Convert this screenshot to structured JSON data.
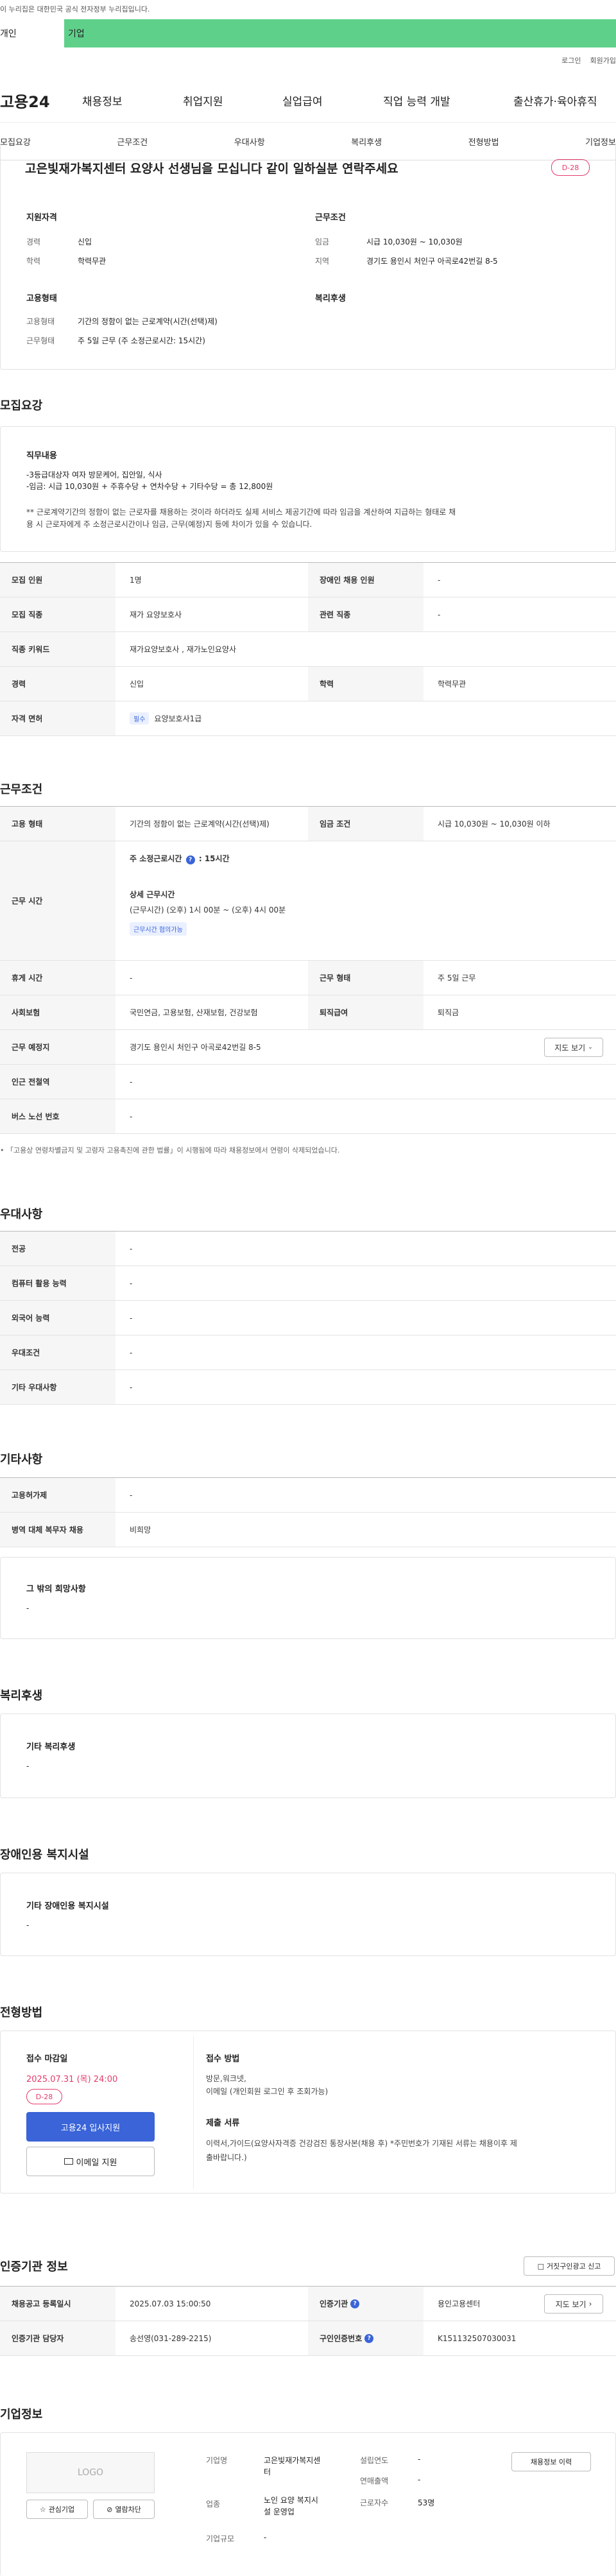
{
  "gov_banner": "이 누리집은 대한민국 공식 전자정부 누리집입니다.",
  "user_tabs": {
    "personal": "개인",
    "company": "기업"
  },
  "top_links": {
    "login": "로그인",
    "signup": "회원가입"
  },
  "gnb": {
    "logo": "고용24",
    "items": [
      "채용정보",
      "취업지원",
      "실업급여",
      "직업 능력 개발",
      "출산휴가·육아휴직"
    ]
  },
  "snb": [
    "모집요강",
    "근무조건",
    "우대사항",
    "복리후생",
    "전형방법",
    "기업정보"
  ],
  "job": {
    "title": "고은빛재가복지센터 요양사 선생님을 모십니다 같이 일하실분 연락주세요",
    "dday": "D-28",
    "qual_title": "지원자격",
    "career_label": "경력",
    "career_value": "신입",
    "edu_label": "학력",
    "edu_value": "학력무관",
    "cond_title": "근무조건",
    "wage_label": "임금",
    "wage_value": "시급 10,030원 ~ 10,030원",
    "region_label": "지역",
    "region_value": "경기도 용인시 처인구 아곡로42번길 8-5",
    "employ_title": "고용형태",
    "employ_type_label": "고용형태",
    "employ_type_value": "기간의 정함이 없는 근로계약(시간(선택)제)",
    "work_form_label": "근무형태",
    "work_form_value": "주 5일 근무 (주 소정근로시간: 15시간)",
    "welfare_title": "복리후생"
  },
  "recruit": {
    "section_title": "모집요강",
    "duty_title": "직무내용",
    "duty_lines": [
      "-3등급대상자 여자 방문케어, 집안일, 식사",
      "-임금: 시급 10,030원 + 주휴수당 + 연차수당 + 기타수당 = 총 12,800원"
    ],
    "notice_lines": [
      "** 근로계약기간의 정함이 없는 근로자를 채용하는 것이라 하더라도 실제 서비스 제공기간에 따라 임금을 계산하여 지급하는 형태로 채",
      "용 시 근로자에게 주 소정근로시간이나 임금, 근무(예정)지 등에 차이가 있을 수 있습니다."
    ],
    "count_label": "모집 인원",
    "count_value": "1명",
    "disabled_label": "장애인 채용 인원",
    "disabled_value": "-",
    "job_label": "모집 직종",
    "job_value": "재가 요양보호사",
    "related_label": "관련 직종",
    "related_value": "-",
    "keyword_label": "직종 키워드",
    "keyword_value": "재가요양보호사 , 재가노인요양사",
    "career_label": "경력",
    "career_value": "신입",
    "edu_label": "학력",
    "edu_value": "학력무관",
    "license_label": "자격 면허",
    "license_tag": "필수",
    "license_value": "요양보호사1급"
  },
  "work": {
    "section_title": "근무조건",
    "employ_label": "고용 형태",
    "employ_value": "기간의 정함이 없는 근로계약(시간(선택)제)",
    "wage_label": "임금 조건",
    "wage_value": "시급 10,030원 ~ 10,030원 이하",
    "hours_label": "근무 시간",
    "weekly_hours": "주 소정근로시간",
    "weekly_hours_value": ": 15시간",
    "detail_title": "상세 근무시간",
    "detail_value": "(근무시간) (오후) 1시 00분 ~ (오후) 4시 00분",
    "negotiable_tag": "근무시간 협의가능",
    "break_label": "휴게 시간",
    "break_value": "-",
    "form_label": "근무 형태",
    "form_value": "주 5일 근무",
    "insurance_label": "사회보험",
    "insurance_value": "국민연금, 고용보험, 산재보험, 건강보험",
    "severance_label": "퇴직급여",
    "severance_value": "퇴직금",
    "place_label": "근무 예정지",
    "place_value": "경기도 용인시 처인구 아곡로42번길 8-5",
    "map_button": "지도 보기",
    "subway_label": "인근 전철역",
    "subway_value": "-",
    "bus_label": "버스 노선 번호",
    "bus_value": "-",
    "footnote": "「고용상 연령차별금지 및 고령자 고용촉진에 관한 법률」이 시행됨에 따라 채용정보에서 연령이 삭제되었습니다."
  },
  "pref": {
    "section_title": "우대사항",
    "rows": [
      {
        "label": "전공",
        "value": "-"
      },
      {
        "label": "컴퓨터 활용 능력",
        "value": "-"
      },
      {
        "label": "외국어 능력",
        "value": "-"
      },
      {
        "label": "우대조건",
        "value": "-"
      },
      {
        "label": "기타 우대사항",
        "value": "-"
      }
    ]
  },
  "etc": {
    "section_title": "기타사항",
    "disabled_label": "고용허가제",
    "disabled_value": "-",
    "military_label": "병역 대체 복무자 채용",
    "military_value": "비희망",
    "other_title": "그 밖의 희망사항",
    "other_value": "-"
  },
  "welfare": {
    "section_title": "복리후생",
    "box_title": "기타 복리후생",
    "box_value": "-"
  },
  "facility": {
    "section_title": "장애인용 복지시설",
    "box_title": "기타 장애인용 복지시설",
    "box_value": "-"
  },
  "process": {
    "section_title": "전형방법",
    "deadline_title": "접수 마감일",
    "deadline_value": "2025.07.31 (목) 24:00",
    "dday": "D-28",
    "apply_button": "고용24 입사지원",
    "email_button": "이메일 지원",
    "method_title": "접수 방법",
    "method_lines": [
      "방문,워크넷,",
      "이메일 (개인회원 로그인 후 조회가능)"
    ],
    "docs_title": "제출 서류",
    "docs_lines": [
      "이력서,가이드(요양사자격증 건강검진 통장사본(채용 후) *주민번호가 기재된 서류는 채용이후 제",
      "출바랍니다.)"
    ]
  },
  "cert": {
    "section_title": "인증기관 정보",
    "report_button": "거짓구인광고 신고",
    "reg_label": "채용공고 등록일시",
    "reg_value": "2025.07.03 15:00:50",
    "org_label": "인증기관",
    "org_value": "용인고용센터",
    "map_button": "지도 보기",
    "manager_label": "인증기관 담당자",
    "manager_value": "송선영(031-289-2215)",
    "certno_label": "구인인증번호",
    "certno_value": "K151132507030031"
  },
  "company": {
    "section_title": "기업정보",
    "logo_text": "LOGO",
    "interest_button": "관심기업",
    "block_button": "열람차단",
    "name_label": "기업명",
    "name_lines": [
      "고은빛재가복지센",
      "터"
    ],
    "founded_label": "설립연도",
    "founded_value": "-",
    "industry_label": "업종",
    "industry_lines": [
      "노인 요양 복지시",
      "설 운영업"
    ],
    "revenue_label": "연매출액",
    "revenue_value": "-",
    "staff_label": "근로자수",
    "staff_value": "53명",
    "size_label": "기업규모",
    "size_value": "-",
    "more_button": "채용정보 이력"
  }
}
